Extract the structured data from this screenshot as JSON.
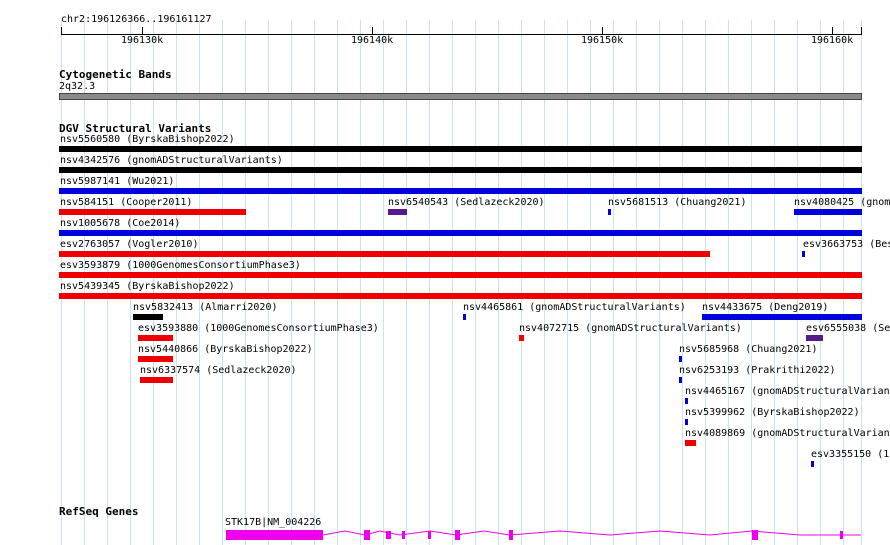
{
  "ruler": {
    "position": "chr2:196126366..196161127",
    "ticks": [
      "196130k",
      "196140k",
      "196150k",
      "196160k"
    ]
  },
  "cytoband": {
    "title": "Cytogenetic Bands",
    "band": "2q32.3",
    "color": "#8a8a8a"
  },
  "dgv": {
    "title": "DGV Structural Variants",
    "colors": {
      "black": "#000000",
      "blue": "#0000dd",
      "red": "#ee0000",
      "purple": "#551a8b"
    },
    "variants": [
      {
        "label": "nsv5560580 (ByrskaBishop2022)",
        "color": "black"
      },
      {
        "label": "nsv4342576 (gnomADStructuralVariants)",
        "color": "black"
      },
      {
        "label": "nsv5987141 (Wu2021)",
        "color": "blue"
      },
      {
        "label": "nsv584151 (Cooper2011)",
        "color": "red"
      },
      {
        "label": "nsv6540543 (Sedlazeck2020)",
        "color": "purple"
      },
      {
        "label": "nsv5681513 (Chuang2021)",
        "color": "blue"
      },
      {
        "label": "nsv4080425 (gnom",
        "color": "blue"
      },
      {
        "label": "nsv1005678 (Coe2014)",
        "color": "blue"
      },
      {
        "label": "esv2763057 (Vogler2010)",
        "color": "red"
      },
      {
        "label": "esv3663753 (Bes",
        "color": "blue"
      },
      {
        "label": "esv3593879 (1000GenomesConsortiumPhase3)",
        "color": "red"
      },
      {
        "label": "nsv5439345 (ByrskaBishop2022)",
        "color": "red"
      },
      {
        "label": "nsv5832413 (Almarri2020)",
        "color": "black"
      },
      {
        "label": "nsv4465861 (gnomADStructuralVariants)",
        "color": "blue"
      },
      {
        "label": "nsv4433675 (Deng2019)",
        "color": "blue"
      },
      {
        "label": "esv3593880 (1000GenomesConsortiumPhase3)",
        "color": "red"
      },
      {
        "label": "nsv4072715 (gnomADStructuralVariants)",
        "color": "red"
      },
      {
        "label": "esv6555038 (Se",
        "color": "purple"
      },
      {
        "label": "nsv5440866 (ByrskaBishop2022)",
        "color": "red"
      },
      {
        "label": "nsv5685968 (Chuang2021)",
        "color": "blue"
      },
      {
        "label": "nsv6337574 (Sedlazeck2020)",
        "color": "red"
      },
      {
        "label": "nsv6253193 (Prakrithi2022)",
        "color": "blue"
      },
      {
        "label": "nsv4465167 (gnomADStructuralVarian",
        "color": "blue"
      },
      {
        "label": "nsv5399962 (ByrskaBishop2022)",
        "color": "blue"
      },
      {
        "label": "nsv4089869 (gnomADStructuralVarian",
        "color": "red"
      },
      {
        "label": "esv3355150 (1(",
        "color": "blue"
      }
    ]
  },
  "refseq": {
    "title": "RefSeq Genes",
    "gene_label": "STK17B|NM_004226",
    "color": "#ee00ee"
  }
}
